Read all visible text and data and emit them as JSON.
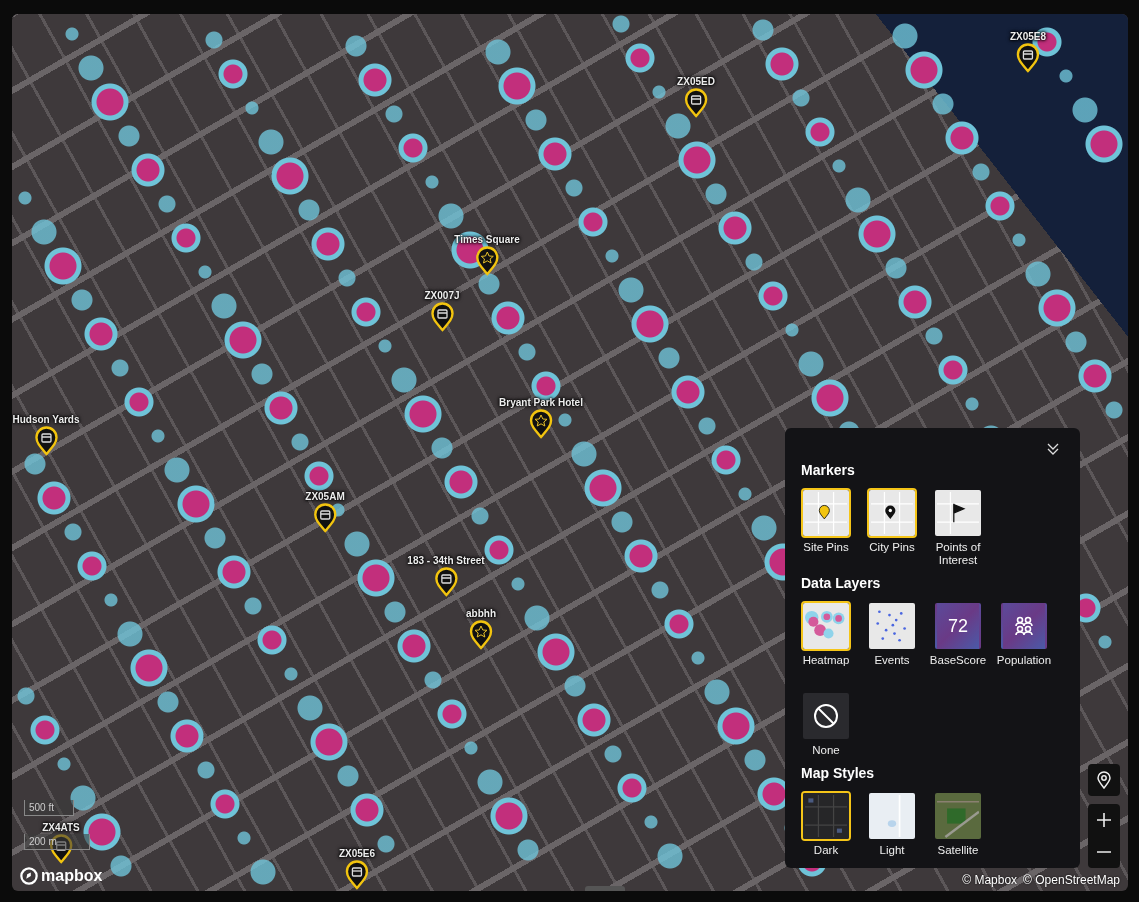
{
  "markers": [
    {
      "label": "ZX05E8",
      "kind": "site"
    },
    {
      "label": "ZX05ED",
      "kind": "site"
    },
    {
      "label": "Times Square",
      "kind": "star"
    },
    {
      "label": "ZX007J",
      "kind": "site"
    },
    {
      "label": "Bryant Park Hotel",
      "kind": "star"
    },
    {
      "label": "Hudson Yards",
      "kind": "site"
    },
    {
      "label": "ZX05AM",
      "kind": "site"
    },
    {
      "label": "183 - 34th Street",
      "kind": "site"
    },
    {
      "label": "abbhh",
      "kind": "star"
    },
    {
      "label": "ZX4ATS",
      "kind": "site"
    },
    {
      "label": "ZX05E6",
      "kind": "site"
    }
  ],
  "scale": {
    "feet": "500 ft",
    "meters": "200 m"
  },
  "logo": "mapbox",
  "attribution": [
    "© Mapbox",
    "© OpenStreetMap"
  ],
  "panel": {
    "sections": [
      {
        "title": "Markers",
        "options": [
          {
            "label": "Site Pins",
            "kind": "site-pins",
            "selected": true
          },
          {
            "label": "City Pins",
            "kind": "city-pins",
            "selected": true
          },
          {
            "label": "Points of Interest",
            "kind": "poi",
            "selected": false
          }
        ]
      },
      {
        "title": "Data Layers",
        "options": [
          {
            "label": "Heatmap",
            "kind": "heatmap",
            "selected": true
          },
          {
            "label": "Events",
            "kind": "events",
            "selected": false
          },
          {
            "label": "BaseScore",
            "kind": "basescore",
            "value": "72",
            "selected": false
          },
          {
            "label": "Population",
            "kind": "population",
            "selected": false
          },
          {
            "label": "None",
            "kind": "none",
            "selected": false
          }
        ]
      },
      {
        "title": "Map Styles",
        "options": [
          {
            "label": "Dark",
            "kind": "dark",
            "selected": true
          },
          {
            "label": "Light",
            "kind": "light",
            "selected": false
          },
          {
            "label": "Satellite",
            "kind": "satellite",
            "selected": false
          }
        ]
      }
    ]
  }
}
